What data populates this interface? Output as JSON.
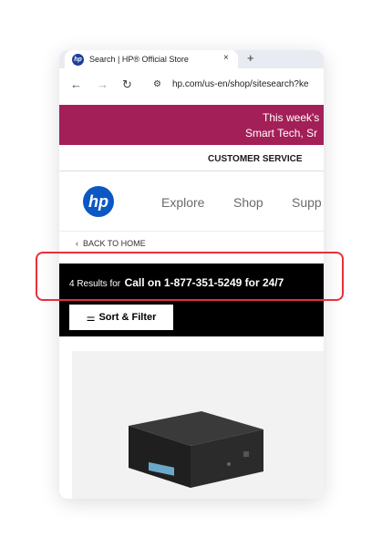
{
  "browser": {
    "tab_title": "Search | HP® Official Store",
    "tab_close": "×",
    "new_tab": "+",
    "favicon_text": "hp",
    "url": "hp.com/us-en/shop/sitesearch?ke",
    "icons": [
      "back-arrow-icon",
      "forward-arrow-icon",
      "reload-icon",
      "site-settings-icon"
    ]
  },
  "promo": {
    "line1": "This week's",
    "line2": "Smart Tech, Sr",
    "color": "#a31f57"
  },
  "header": {
    "customer_service": "CUSTOMER SERVICE",
    "logo_text": "hp",
    "nav": [
      "Explore",
      "Shop",
      "Supp"
    ]
  },
  "breadcrumb": {
    "back_label": "BACK TO HOME"
  },
  "results": {
    "count_text": "4 Results for",
    "query_text": "Call on 1-877-351-5249 for 24/7",
    "filter_label": "Sort & Filter"
  },
  "highlight_color": "#e8303a"
}
